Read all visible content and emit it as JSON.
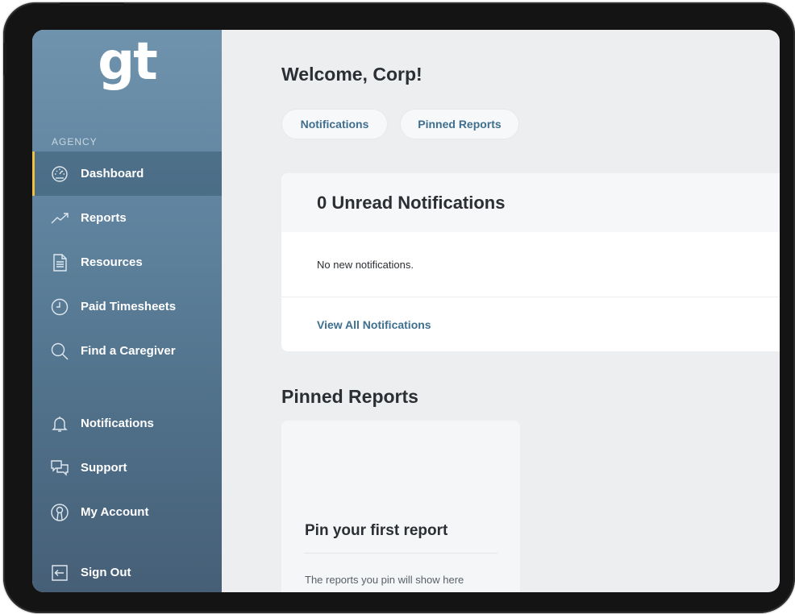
{
  "sidebar": {
    "logo": "gt",
    "section_label": "AGENCY",
    "nav": [
      {
        "label": "Dashboard",
        "icon": "dashboard-gauge-icon",
        "active": true
      },
      {
        "label": "Reports",
        "icon": "trend-line-icon"
      },
      {
        "label": "Resources",
        "icon": "document-icon"
      },
      {
        "label": "Paid Timesheets",
        "icon": "clock-icon"
      },
      {
        "label": "Find a Caregiver",
        "icon": "search-icon"
      },
      {
        "label": "Notifications",
        "icon": "bell-icon"
      },
      {
        "label": "Support",
        "icon": "chat-bubbles-icon"
      },
      {
        "label": "My Account",
        "icon": "user-circle-icon"
      },
      {
        "label": "Sign Out",
        "icon": "sign-out-icon"
      }
    ]
  },
  "main": {
    "welcome": "Welcome, Corp!",
    "tabs": [
      {
        "label": "Notifications"
      },
      {
        "label": "Pinned Reports"
      }
    ],
    "notifications_card": {
      "title": "0 Unread Notifications",
      "body": "No new notifications.",
      "link": "View All Notifications"
    },
    "pinned_section": {
      "title": "Pinned Reports",
      "card_title": "Pin your first report",
      "card_text": "The reports you pin will show here"
    }
  },
  "colors": {
    "accent_text": "#3e6f8f",
    "active_indicator": "#f0c040",
    "sidebar_top": "#6f93ad",
    "sidebar_bottom": "#465f77"
  }
}
